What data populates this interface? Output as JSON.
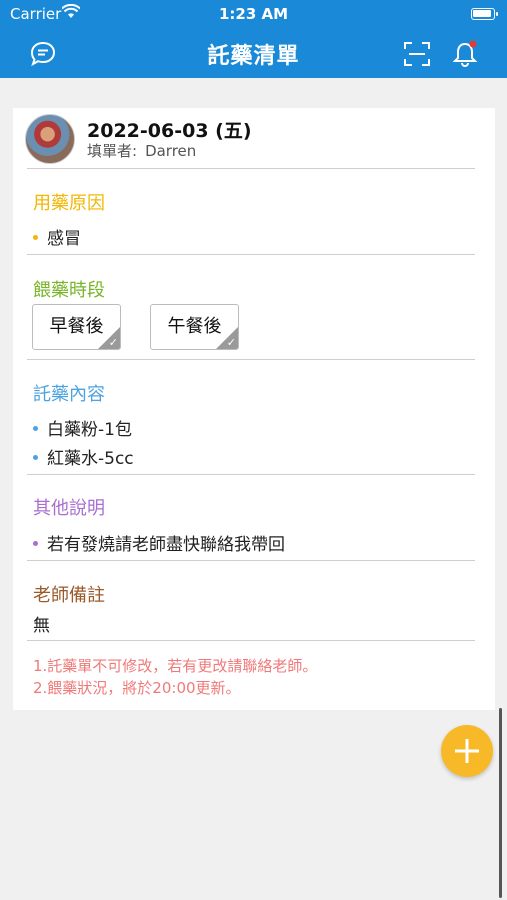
{
  "status_bar": {
    "carrier": "Carrier",
    "time": "1:23 AM"
  },
  "header": {
    "title": "託藥清單"
  },
  "entry": {
    "date": "2022-06-03 (五)",
    "filler_label": "填單者:",
    "filler_name": "Darren"
  },
  "sections": {
    "reason": {
      "title": "用藥原因",
      "color": "#f2b705",
      "items": [
        "感冒"
      ]
    },
    "timing": {
      "title": "餵藥時段",
      "color": "#78b52a",
      "options": [
        "早餐後",
        "午餐後"
      ]
    },
    "content": {
      "title": "託藥內容",
      "color": "#4da3e0",
      "items": [
        "白藥粉-1包",
        "紅藥水-5cc"
      ]
    },
    "other": {
      "title": "其他說明",
      "color": "#a86fd0",
      "items": [
        "若有發燒請老師盡快聯絡我帶回"
      ]
    },
    "teacher": {
      "title": "老師備註",
      "color": "#9a5a2a",
      "value": "無"
    }
  },
  "notes": [
    "1.託藥單不可修改，若有更改請聯絡老師。",
    "2.餵藥狀況，將於20:00更新。"
  ],
  "colors": {
    "primary": "#1a8ad8",
    "fab": "#f7b928",
    "note": "#f07a7a"
  },
  "icons": [
    "chat-icon",
    "scan-icon",
    "bell-icon",
    "check-icon",
    "plus-icon",
    "wifi-icon",
    "battery-icon"
  ]
}
